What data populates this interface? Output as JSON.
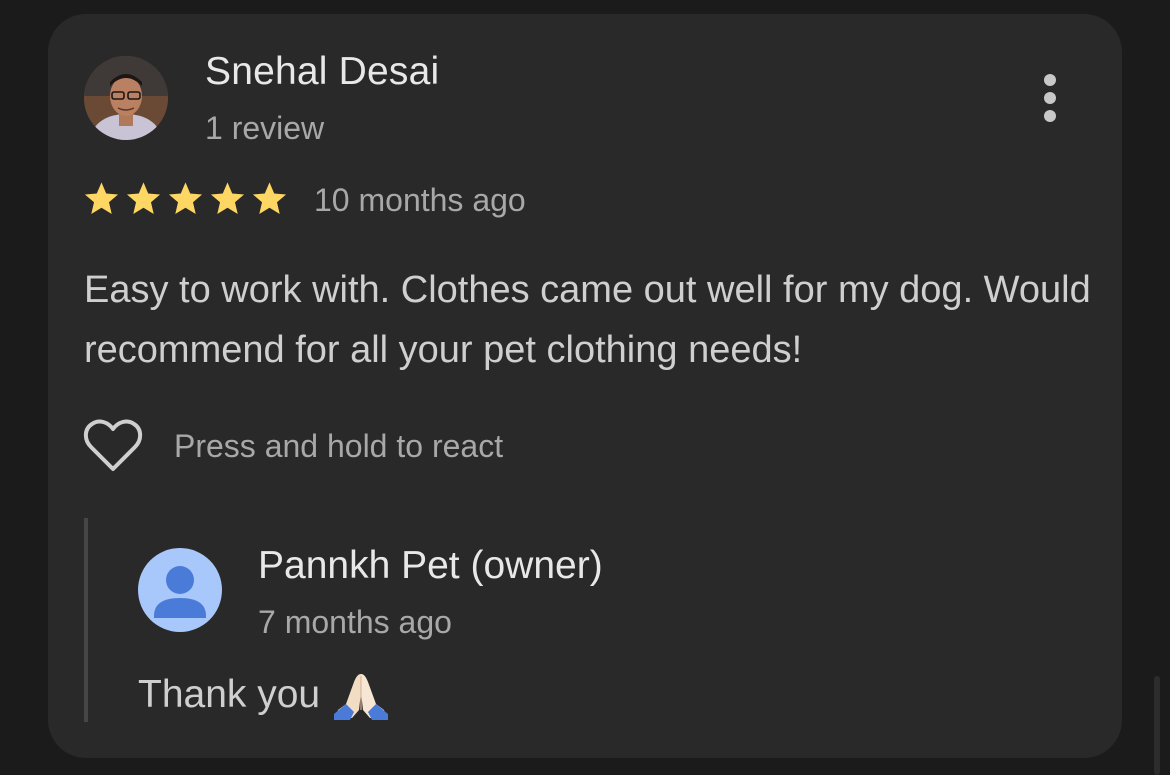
{
  "review": {
    "reviewer_name": "Snehal Desai",
    "review_count": "1 review",
    "rating": 5,
    "rating_max": 5,
    "time": "10 months ago",
    "text": "Easy to work with. Clothes came out well for my dog. Would recommend for all your pet clothing needs!",
    "react_label": "Press and hold to react"
  },
  "reply": {
    "owner_name": "Pannkh Pet (owner)",
    "time": "7 months ago",
    "text": "Thank you"
  },
  "colors": {
    "background": "#1b1b1b",
    "card": "#292929",
    "star": "#fdd663",
    "owner_avatar": "#a8c7fa",
    "owner_avatar_person": "#4a7bd8"
  },
  "icons": {
    "more": "more-vert-icon",
    "star": "star-icon",
    "heart": "heart-outline-icon",
    "owner_avatar": "person-icon",
    "reply_emoji": "folded-hands-icon"
  }
}
